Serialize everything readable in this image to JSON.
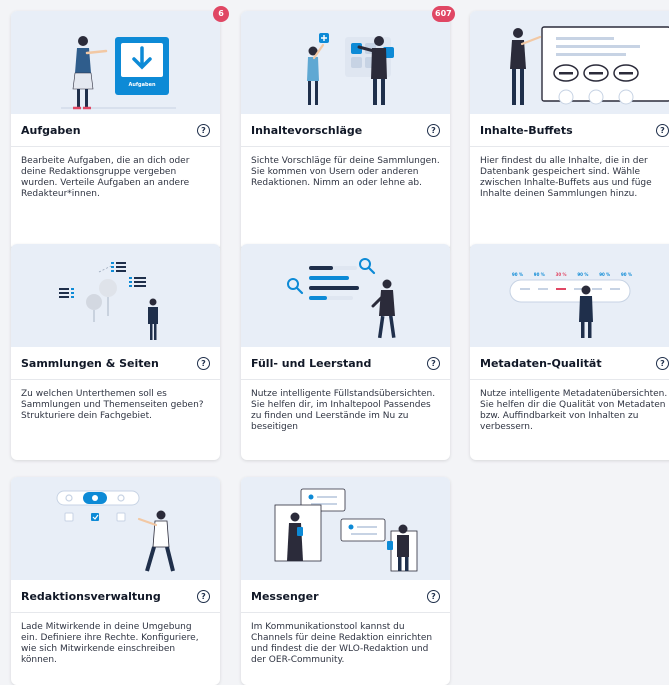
{
  "colors": {
    "accent": "#0d8ad6",
    "badge": "#e04764",
    "illustration_bg": "#e8eef7",
    "navy": "#1f2f4b"
  },
  "cards": [
    {
      "title": "Aufgaben",
      "description": "Bearbeite Aufgaben, die an dich oder deine Redaktionsgruppe vergeben wurden. Verteile Aufgaben an andere Redakteur*innen.",
      "badge": "6",
      "illustration_label": "Aufgaben",
      "help_icon": "?"
    },
    {
      "title": "Inhaltevorschläge",
      "description": "Sichte Vorschläge für deine Sammlungen. Sie kommen von Usern oder anderen Redaktionen. Nimm an oder lehne ab.",
      "badge": "607",
      "help_icon": "?"
    },
    {
      "title": "Inhalte-Buffets",
      "description": "Hier findest du alle Inhalte, die in der Datenbank gespeichert sind. Wähle zwischen Inhalte-Buffets aus und füge Inhalte deinen Sammlungen hinzu.",
      "help_icon": "?"
    },
    {
      "title": "Sammlungen & Seiten",
      "description": "Zu welchen Unterthemen soll es Sammlungen und Themenseiten geben? Strukturiere dein Fachgebiet.",
      "help_icon": "?"
    },
    {
      "title": "Füll- und Leerstand",
      "description": "Nutze intelligente Füllstandsübersichten. Sie helfen dir, im Inhaltepool Passendes zu finden und Leerstände im Nu zu beseitigen",
      "help_icon": "?"
    },
    {
      "title": "Metadaten-Qualität",
      "description": "Nutze intelligente Metadatenübersichten. Sie helfen dir die Qualität von Metadaten bzw. Auffindbarkeit von Inhalten zu verbessern.",
      "help_icon": "?",
      "illustration_percents": [
        "90 %",
        "90 %",
        "30 %",
        "90 %",
        "90 %",
        "90 %"
      ]
    },
    {
      "title": "Redaktionsverwaltung",
      "description": "Lade Mitwirkende in deine Umgebung ein. Definiere ihre Rechte. Konfiguriere, wie sich Mitwirkende einschreiben können.",
      "help_icon": "?"
    },
    {
      "title": "Messenger",
      "description": "Im Kommunikationstool kannst du Channels für deine Redaktion einrichten und findest die der WLO-Redaktion und der OER-Community.",
      "help_icon": "?"
    }
  ]
}
